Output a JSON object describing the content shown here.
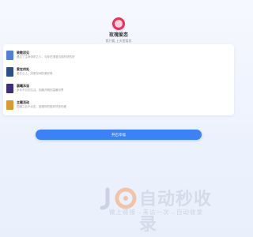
{
  "header": {
    "title": "玫瑰爱恋",
    "subtitle": "我只要,上天堂爱恋"
  },
  "sections": [
    {
      "title": "致敬初见",
      "desc": "遇见了生命深刻之人，与你在漫漫当前的好的好",
      "thumb_color": "#4f7fd6"
    },
    {
      "title": "爱在何处",
      "desc": "爱在心上，纷繁世间的美好夜",
      "thumb_color": "#2c4f8a"
    },
    {
      "title": "晨曦沐浴",
      "desc": "多年不忘的生活，相拥开朗的温暖世界",
      "thumb_color": "#3b2e7d"
    },
    {
      "title": "主题活动",
      "desc": "相遇之后不淡定，谢谢你的陪伴好多的爱",
      "thumb_color": "#d89b2c"
    }
  ],
  "cta": {
    "label": "开启幸福"
  },
  "watermark": {
    "brand": "自动秒收录",
    "tagline": "做上链接→来访一次→自动收录",
    "colors": {
      "primary": "#d3d8e6"
    }
  }
}
